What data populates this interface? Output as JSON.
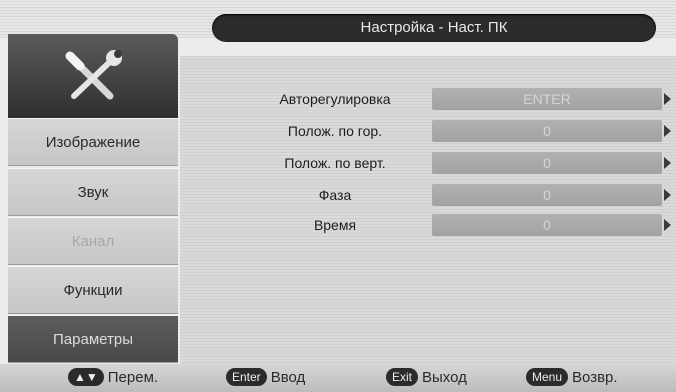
{
  "header": {
    "title": "Настройка - Наст. ПК"
  },
  "sidebar": {
    "logo_icon": "wrench-screwdriver-icon",
    "items": [
      {
        "label": "Изображение",
        "state": "normal"
      },
      {
        "label": "Звук",
        "state": "normal"
      },
      {
        "label": "Канал",
        "state": "disabled"
      },
      {
        "label": "Функции",
        "state": "normal"
      },
      {
        "label": "Параметры",
        "state": "active"
      }
    ]
  },
  "settings": [
    {
      "label": "Авторегулировка",
      "value": "ENTER"
    },
    {
      "label": "Полож. по гор.",
      "value": "0"
    },
    {
      "label": "Полож. по верт.",
      "value": "0"
    },
    {
      "label": "Фаза",
      "value": "0"
    },
    {
      "label": "Время",
      "value": "0"
    }
  ],
  "footer": {
    "hints": [
      {
        "key": "▲▼",
        "label": "Перем."
      },
      {
        "key": "Enter",
        "label": "Ввод"
      },
      {
        "key": "Exit",
        "label": "Выход"
      },
      {
        "key": "Menu",
        "label": "Возвр."
      }
    ]
  },
  "colors": {
    "active_item": "#4f4f4f",
    "title_bar": "#2b2b2b",
    "value_box": "#a8a8a8"
  }
}
